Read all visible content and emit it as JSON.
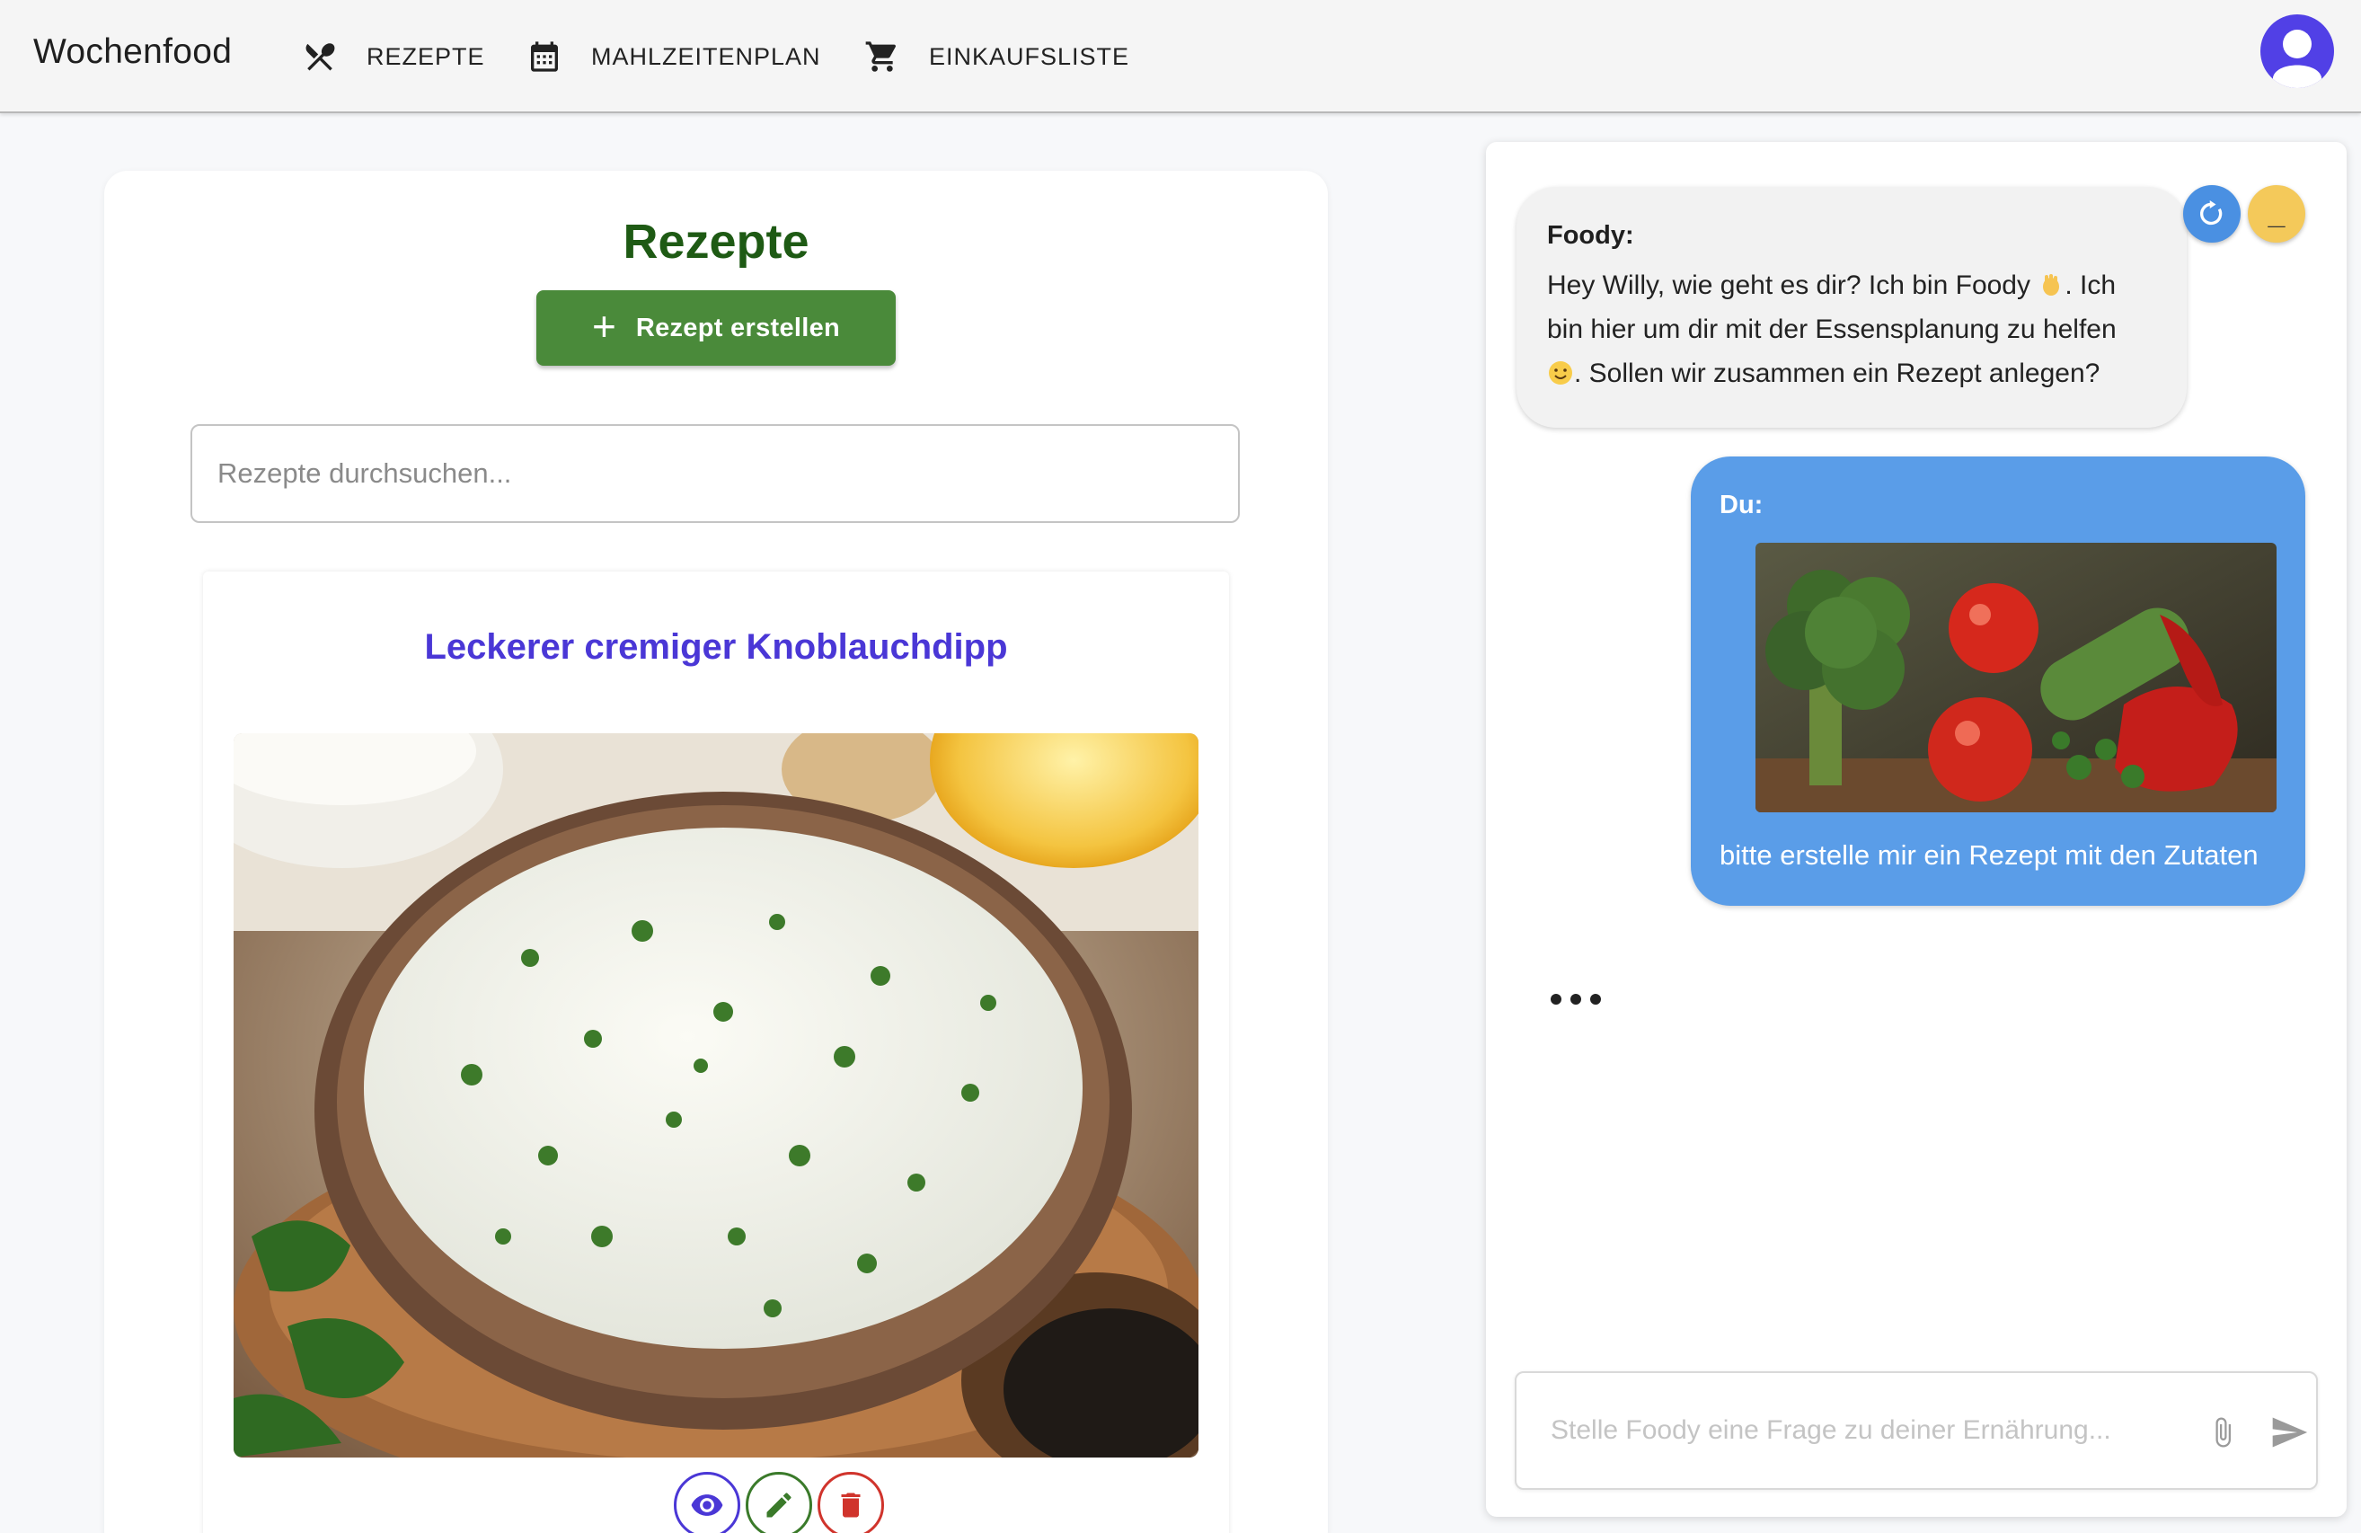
{
  "header": {
    "brand": "Wochenfood",
    "nav": [
      {
        "label": "REZEPTE",
        "icon": "utensils-icon"
      },
      {
        "label": "MAHLZEITENPLAN",
        "icon": "calendar-icon"
      },
      {
        "label": "EINKAUFSLISTE",
        "icon": "cart-icon"
      }
    ],
    "avatar_icon": "user-avatar-icon",
    "avatar_color": "#5140e6"
  },
  "recipes": {
    "title": "Rezepte",
    "create_button": {
      "icon": "+",
      "label": "Rezept erstellen"
    },
    "search": {
      "placeholder": "Rezepte durchsuchen...",
      "value": ""
    },
    "cards": [
      {
        "title": "Leckerer cremiger Knoblauchdipp",
        "image": "garlic-dip-bowl-photo",
        "actions": [
          "view-icon",
          "edit-icon",
          "delete-icon"
        ]
      }
    ]
  },
  "chat": {
    "controls": {
      "restart_icon": "restart-icon",
      "minimize_label": "_"
    },
    "messages": [
      {
        "sender": "Foody:",
        "text_part1": "Hey Willy, wie geht es dir? Ich bin Foody",
        "emoji1": "waving-hand",
        "text_part2": ". Ich bin hier um dir mit der Essensplanung zu helfen",
        "emoji2": "smiling-face",
        "text_part3": ". Sollen wir zusammen ein Rezept anlegen?"
      },
      {
        "sender": "Du:",
        "image": "vegetables-photo",
        "text": "bitte erstelle mir ein Rezept mit den Zutaten"
      }
    ],
    "typing_indicator": true,
    "input": {
      "placeholder": "Stelle Foody eine Frage zu deiner Ernährung...",
      "value": ""
    }
  },
  "colors": {
    "accent_green": "#4a8a3a",
    "title_green": "#1e5a14",
    "recipe_title": "#4a37d6",
    "user_bubble": "#5a9de8",
    "bot_bubble": "#f2f2f2",
    "delete_red": "#d0342c"
  }
}
